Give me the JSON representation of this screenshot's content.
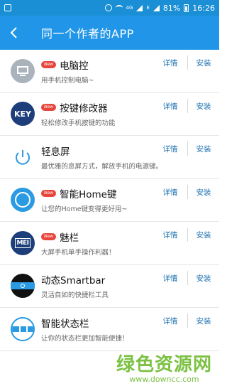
{
  "status_bar": {
    "network": "4G",
    "network_small": "4G",
    "carrier_icon": "E",
    "battery": "81%",
    "time": "16:26"
  },
  "app_bar": {
    "title": "同一个作者的APP",
    "back_icon": "back-arrow-icon"
  },
  "apps": [
    {
      "name": "电脑控",
      "desc": "用手机控制电脑~",
      "new": true,
      "new_label": "New",
      "detail": "详情",
      "install": "安装",
      "icon": "monitor-icon"
    },
    {
      "name": "按键修改器",
      "desc": "轻松修改手机按键的功能",
      "new": true,
      "new_label": "New",
      "detail": "详情",
      "install": "安装",
      "icon": "key-icon",
      "icon_text": "KEY"
    },
    {
      "name": "轻息屏",
      "desc": "最优雅的息屏方式，解放手机的电源键。",
      "new": false,
      "detail": "详情",
      "install": "安装",
      "icon": "power-icon"
    },
    {
      "name": "智能Home键",
      "desc": "让您的Home键变得更好用~",
      "new": true,
      "new_label": "New",
      "detail": "详情",
      "install": "安装",
      "icon": "home-circle-icon"
    },
    {
      "name": "魅栏",
      "desc": "大屏手机单手操作利器！",
      "new": true,
      "new_label": "New",
      "detail": "详情",
      "install": "安装",
      "icon": "mei-icon",
      "icon_text": "MEI"
    },
    {
      "name": "动态Smartbar",
      "desc": "灵活自如的快捷栏工具",
      "new": false,
      "detail": "详情",
      "install": "安装",
      "icon": "smartbar-icon"
    },
    {
      "name": "智能状态栏",
      "desc": "让你的状态栏更加智能便捷！",
      "new": false,
      "detail": "详情",
      "install": "安装",
      "icon": "statusbar-icon"
    }
  ],
  "watermark": {
    "main": "绿色资源网",
    "sub": "www.downcc.com"
  },
  "colors": {
    "status_bar": "#1b8fd6",
    "app_bar": "#2196e8",
    "new_badge": "#e8453c",
    "link": "#1a6fb0",
    "watermark": "#7cc143"
  }
}
